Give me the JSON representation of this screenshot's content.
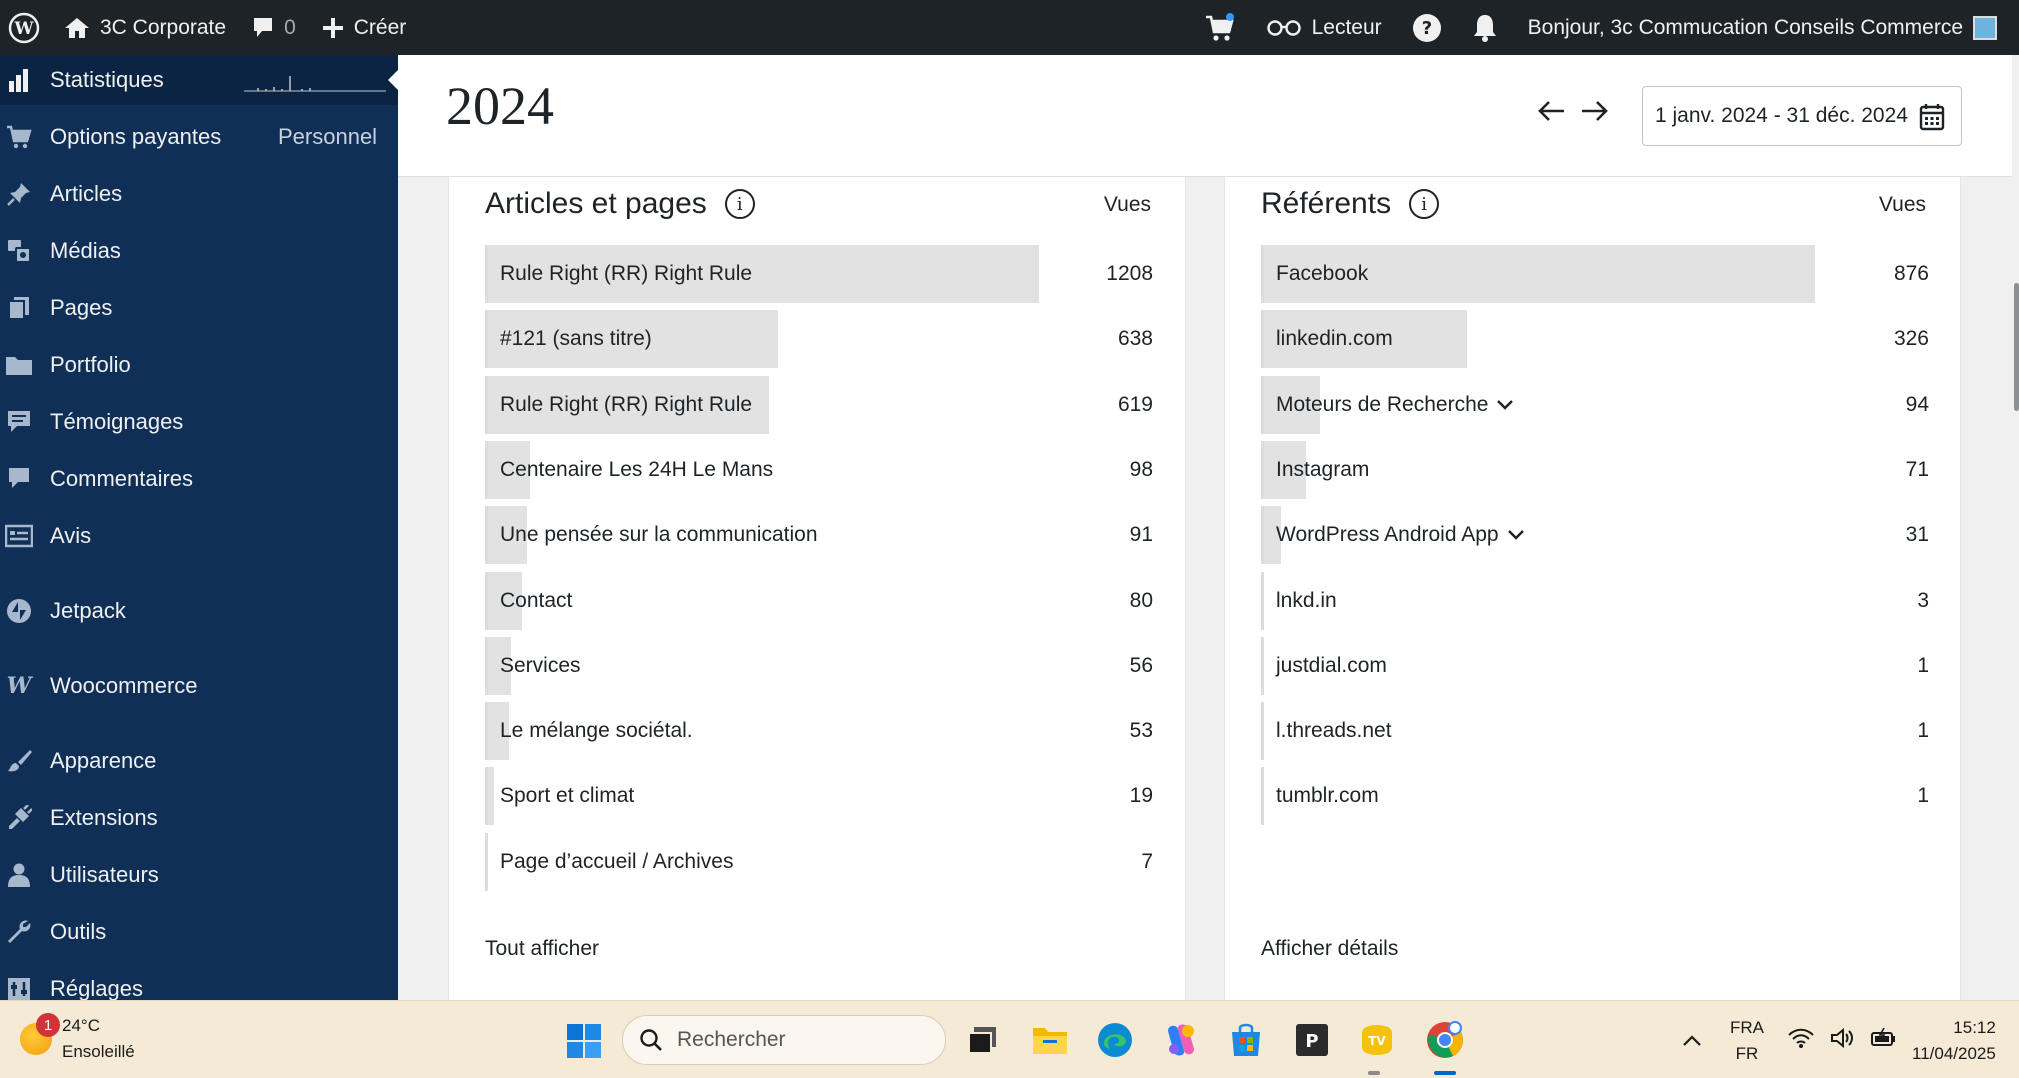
{
  "adminbar": {
    "site_name": "3C Corporate",
    "comments_count": "0",
    "new_label": "Créer",
    "reader_label": "Lecteur",
    "greeting": "Bonjour, 3c Commucation Conseils Commerce"
  },
  "sidebar": {
    "items": [
      {
        "label": "Statistiques",
        "icon": "bar-chart-icon"
      },
      {
        "label": "Options payantes",
        "icon": "cart-icon",
        "extra": "Personnel"
      },
      {
        "label": "Articles",
        "icon": "pin-icon"
      },
      {
        "label": "Médias",
        "icon": "media-icon"
      },
      {
        "label": "Pages",
        "icon": "pages-icon"
      },
      {
        "label": "Portfolio",
        "icon": "folder-icon"
      },
      {
        "label": "Témoignages",
        "icon": "testimonial-icon"
      },
      {
        "label": "Commentaires",
        "icon": "comment-icon"
      },
      {
        "label": "Avis",
        "icon": "feedback-icon"
      },
      {
        "label": "Jetpack",
        "icon": "jetpack-icon"
      },
      {
        "label": "Woocommerce",
        "icon": "woo-icon"
      },
      {
        "label": "Apparence",
        "icon": "brush-icon"
      },
      {
        "label": "Extensions",
        "icon": "plugin-icon"
      },
      {
        "label": "Utilisateurs",
        "icon": "user-icon"
      },
      {
        "label": "Outils",
        "icon": "wrench-icon"
      },
      {
        "label": "Réglages",
        "icon": "settings-icon"
      }
    ]
  },
  "header": {
    "year": "2024",
    "date_range": "1 janv. 2024 - 31 déc. 2024"
  },
  "articles": {
    "title": "Articles et pages",
    "column": "Vues",
    "footer": "Tout afficher",
    "max": 1208,
    "rows": [
      {
        "label": "Rule Right (RR) Right Rule",
        "value": 1208
      },
      {
        "label": "#121 (sans titre)",
        "value": 638
      },
      {
        "label": "Rule Right (RR) Right Rule",
        "value": 619
      },
      {
        "label": "Centenaire Les 24H Le Mans",
        "value": 98
      },
      {
        "label": "Une pensée sur la communication",
        "value": 91
      },
      {
        "label": "Contact",
        "value": 80
      },
      {
        "label": "Services",
        "value": 56
      },
      {
        "label": "Le mélange sociétal.",
        "value": 53
      },
      {
        "label": "Sport et climat",
        "value": 19
      },
      {
        "label": "Page d’accueil / Archives",
        "value": 7
      }
    ]
  },
  "referents": {
    "title": "Référents",
    "column": "Vues",
    "footer": "Afficher détails",
    "max": 876,
    "rows": [
      {
        "label": "Facebook",
        "value": 876,
        "expandable": false
      },
      {
        "label": "linkedin.com",
        "value": 326,
        "expandable": false
      },
      {
        "label": "Moteurs de Recherche",
        "value": 94,
        "expandable": true
      },
      {
        "label": "Instagram",
        "value": 71,
        "expandable": false
      },
      {
        "label": "WordPress Android App",
        "value": 31,
        "expandable": true
      },
      {
        "label": "lnkd.in",
        "value": 3,
        "expandable": false
      },
      {
        "label": "justdial.com",
        "value": 1,
        "expandable": false
      },
      {
        "label": "l.threads.net",
        "value": 1,
        "expandable": false
      },
      {
        "label": "tumblr.com",
        "value": 1,
        "expandable": false
      }
    ]
  },
  "taskbar": {
    "weather_temp": "24°C",
    "weather_desc": "Ensoleillé",
    "weather_badge": "1",
    "search_placeholder": "Rechercher",
    "lang_top": "FRA",
    "lang_bottom": "FR",
    "time": "15:12",
    "date": "11/04/2025"
  }
}
